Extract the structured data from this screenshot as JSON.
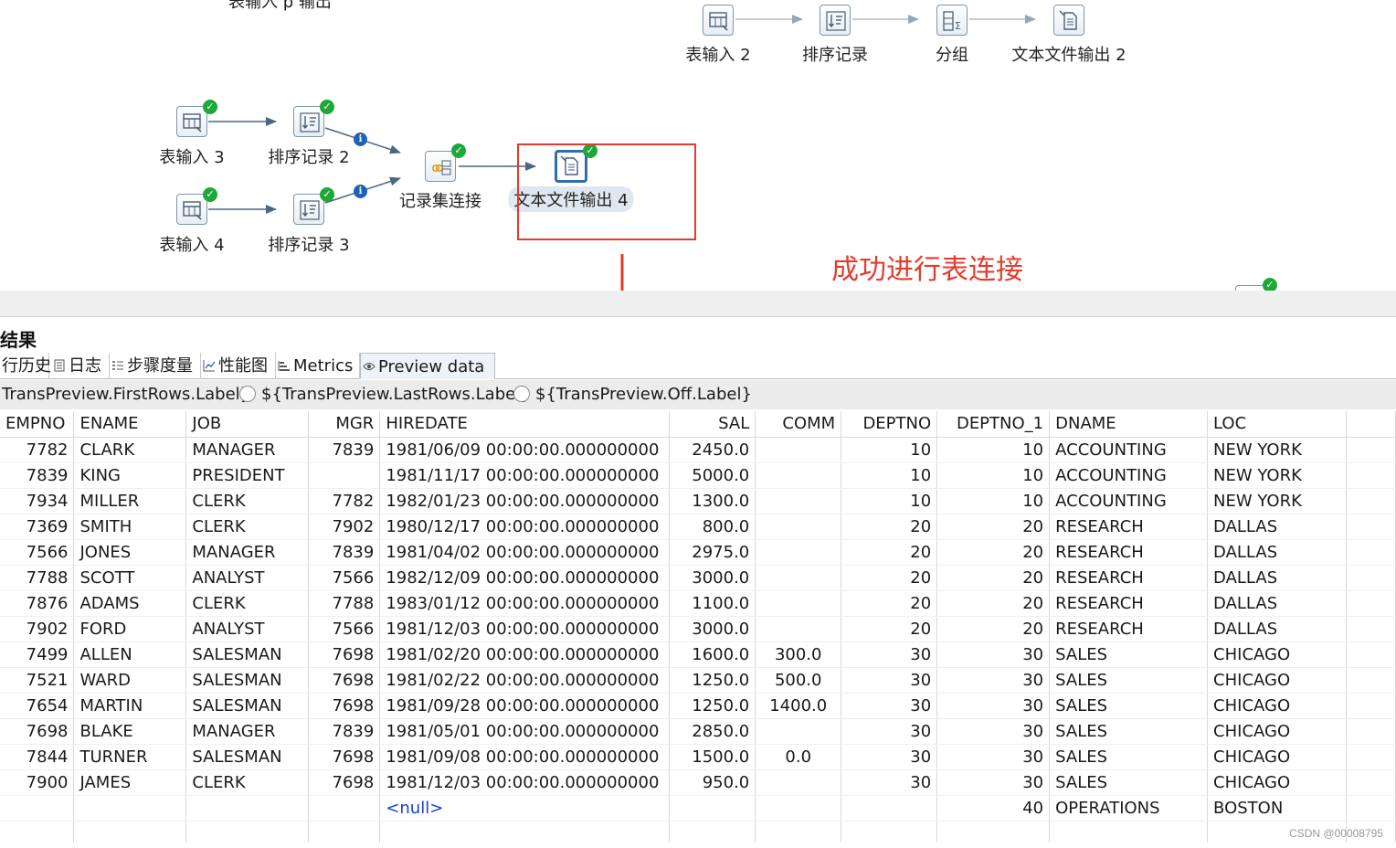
{
  "canvas": {
    "cut_top_label": "表输入                    p        输出",
    "steps": [
      {
        "id": "table_input_2",
        "label": "表输入 2"
      },
      {
        "id": "sort_rows_top",
        "label": "排序记录"
      },
      {
        "id": "group_by",
        "label": "分组"
      },
      {
        "id": "text_output_2",
        "label": "文本文件输出 2"
      },
      {
        "id": "table_input_3",
        "label": "表输入 3"
      },
      {
        "id": "sort_rows_2",
        "label": "排序记录 2"
      },
      {
        "id": "merge_join",
        "label": "记录集连接"
      },
      {
        "id": "text_output_4",
        "label": "文本文件输出 4"
      },
      {
        "id": "table_input_4",
        "label": "表输入 4"
      },
      {
        "id": "sort_rows_3",
        "label": "排序记录 3"
      }
    ],
    "annotation": "成功进行表连接",
    "colors": {
      "accent_red": "#e53a2c",
      "success_green": "#1ea83a",
      "info_blue": "#1c63b7"
    }
  },
  "panel": {
    "title": "结果",
    "tabs": [
      {
        "label": "行历史",
        "icon": "history-icon"
      },
      {
        "label": "日志",
        "icon": "log-icon"
      },
      {
        "label": "步骤度量",
        "icon": "step-metrics-icon"
      },
      {
        "label": "性能图",
        "icon": "performance-chart-icon"
      },
      {
        "label": "Metrics",
        "icon": "metrics-icon"
      },
      {
        "label": "Preview data",
        "icon": "eye-icon",
        "active": true
      }
    ],
    "options": [
      "TransPreview.FirstRows.Label}",
      "${TransPreview.LastRows.Label}",
      "${TransPreview.Off.Label}"
    ]
  },
  "grid": {
    "columns": [
      "EMPNO",
      "ENAME",
      "JOB",
      "MGR",
      "HIREDATE",
      "SAL",
      "COMM",
      "DEPTNO",
      "DEPTNO_1",
      "DNAME",
      "LOC"
    ],
    "rows": [
      [
        "7782",
        "CLARK",
        "MANAGER",
        "7839",
        "1981/06/09 00:00:00.000000000",
        "2450.0",
        "",
        "10",
        "10",
        "ACCOUNTING",
        "NEW YORK"
      ],
      [
        "7839",
        "KING",
        "PRESIDENT",
        "",
        "1981/11/17 00:00:00.000000000",
        "5000.0",
        "",
        "10",
        "10",
        "ACCOUNTING",
        "NEW YORK"
      ],
      [
        "7934",
        "MILLER",
        "CLERK",
        "7782",
        "1982/01/23 00:00:00.000000000",
        "1300.0",
        "",
        "10",
        "10",
        "ACCOUNTING",
        "NEW YORK"
      ],
      [
        "7369",
        "SMITH",
        "CLERK",
        "7902",
        "1980/12/17 00:00:00.000000000",
        "800.0",
        "",
        "20",
        "20",
        "RESEARCH",
        "DALLAS"
      ],
      [
        "7566",
        "JONES",
        "MANAGER",
        "7839",
        "1981/04/02 00:00:00.000000000",
        "2975.0",
        "",
        "20",
        "20",
        "RESEARCH",
        "DALLAS"
      ],
      [
        "7788",
        "SCOTT",
        "ANALYST",
        "7566",
        "1982/12/09 00:00:00.000000000",
        "3000.0",
        "",
        "20",
        "20",
        "RESEARCH",
        "DALLAS"
      ],
      [
        "7876",
        "ADAMS",
        "CLERK",
        "7788",
        "1983/01/12 00:00:00.000000000",
        "1100.0",
        "",
        "20",
        "20",
        "RESEARCH",
        "DALLAS"
      ],
      [
        "7902",
        "FORD",
        "ANALYST",
        "7566",
        "1981/12/03 00:00:00.000000000",
        "3000.0",
        "",
        "20",
        "20",
        "RESEARCH",
        "DALLAS"
      ],
      [
        "7499",
        "ALLEN",
        "SALESMAN",
        "7698",
        "1981/02/20 00:00:00.000000000",
        "1600.0",
        "300.0",
        "30",
        "30",
        "SALES",
        "CHICAGO"
      ],
      [
        "7521",
        "WARD",
        "SALESMAN",
        "7698",
        "1981/02/22 00:00:00.000000000",
        "1250.0",
        "500.0",
        "30",
        "30",
        "SALES",
        "CHICAGO"
      ],
      [
        "7654",
        "MARTIN",
        "SALESMAN",
        "7698",
        "1981/09/28 00:00:00.000000000",
        "1250.0",
        "1400.0",
        "30",
        "30",
        "SALES",
        "CHICAGO"
      ],
      [
        "7698",
        "BLAKE",
        "MANAGER",
        "7839",
        "1981/05/01 00:00:00.000000000",
        "2850.0",
        "",
        "30",
        "30",
        "SALES",
        "CHICAGO"
      ],
      [
        "7844",
        "TURNER",
        "SALESMAN",
        "7698",
        "1981/09/08 00:00:00.000000000",
        "1500.0",
        "0.0",
        "30",
        "30",
        "SALES",
        "CHICAGO"
      ],
      [
        "7900",
        "JAMES",
        "CLERK",
        "7698",
        "1981/12/03 00:00:00.000000000",
        "950.0",
        "",
        "30",
        "30",
        "SALES",
        "CHICAGO"
      ],
      [
        "",
        "",
        "",
        "",
        "<null>",
        "",
        "",
        "",
        "40",
        "OPERATIONS",
        "BOSTON"
      ],
      [
        "",
        "",
        "",
        "",
        "",
        "",
        "",
        "",
        "",
        "",
        ""
      ]
    ]
  },
  "watermark": "CSDN @00008795"
}
